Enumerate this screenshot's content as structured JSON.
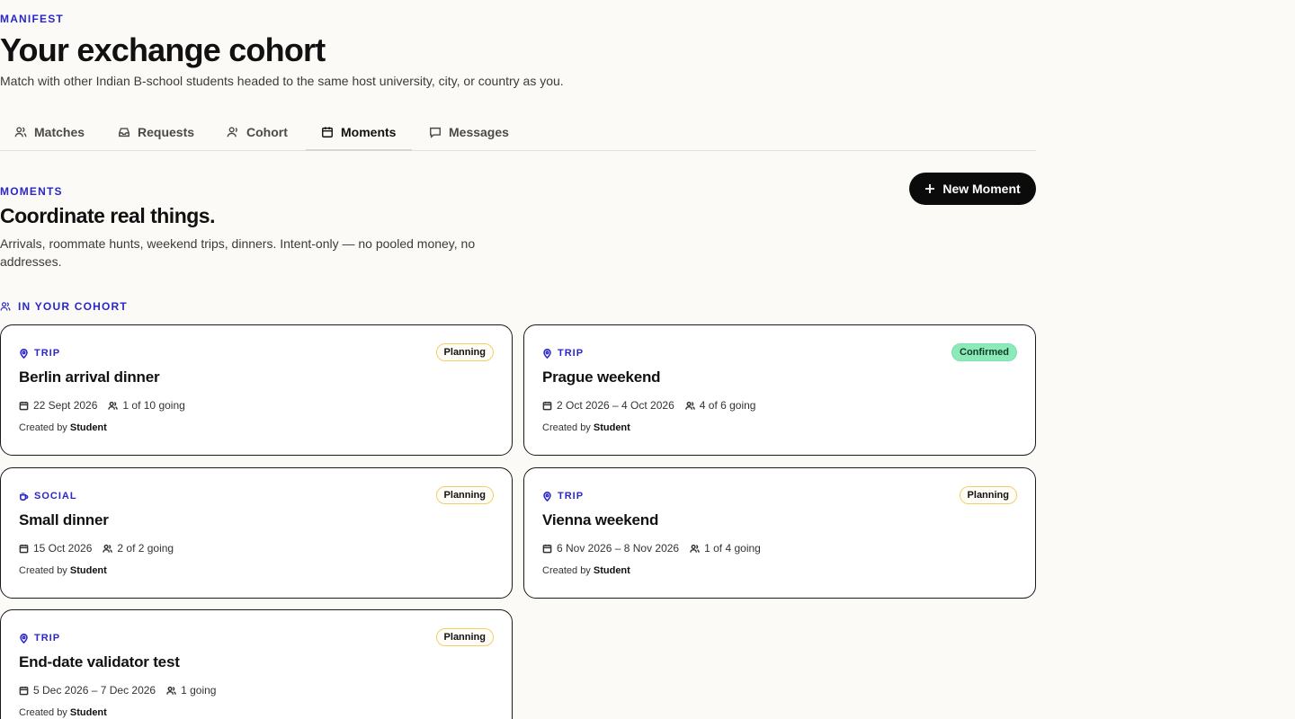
{
  "page": {
    "eyebrow": "MANIFEST",
    "title": "Your exchange cohort",
    "subtitle": "Match with other Indian B-school students headed to the same host university, city, or country as you."
  },
  "tabs": [
    {
      "label": "Matches",
      "icon": "users-icon"
    },
    {
      "label": "Requests",
      "icon": "inbox-icon"
    },
    {
      "label": "Cohort",
      "icon": "user-icon"
    },
    {
      "label": "Moments",
      "icon": "calendar-icon",
      "active": true
    },
    {
      "label": "Messages",
      "icon": "message-icon"
    }
  ],
  "section": {
    "eyebrow": "MOMENTS",
    "title": "Coordinate real things.",
    "subtitle": "Arrivals, roommate hunts, weekend trips, dinners. Intent-only — no pooled money, no addresses.",
    "new_button": "New Moment",
    "group_label": "IN YOUR COHORT"
  },
  "cards": [
    {
      "kind": "TRIP",
      "kind_icon": "map-pin-icon",
      "status": "Planning",
      "title": "Berlin arrival dinner",
      "date": "22 Sept 2026",
      "going": "1 of 10 going",
      "created_prefix": "Created by",
      "creator": "Student"
    },
    {
      "kind": "TRIP",
      "kind_icon": "map-pin-icon",
      "status": "Confirmed",
      "title": "Prague weekend",
      "date": "2 Oct 2026 – 4 Oct 2026",
      "going": "4 of 6 going",
      "created_prefix": "Created by",
      "creator": "Student"
    },
    {
      "kind": "SOCIAL",
      "kind_icon": "cup-icon",
      "status": "Planning",
      "title": "Small dinner",
      "date": "15 Oct 2026",
      "going": "2 of 2 going",
      "created_prefix": "Created by",
      "creator": "Student"
    },
    {
      "kind": "TRIP",
      "kind_icon": "map-pin-icon",
      "status": "Planning",
      "title": "Vienna weekend",
      "date": "6 Nov 2026 – 8 Nov 2026",
      "going": "1 of 4 going",
      "created_prefix": "Created by",
      "creator": "Student"
    },
    {
      "kind": "TRIP",
      "kind_icon": "map-pin-icon",
      "status": "Planning",
      "title": "End-date validator test",
      "date": "5 Dec 2026 – 7 Dec 2026",
      "going": "1 going",
      "created_prefix": "Created by",
      "creator": "Student"
    }
  ],
  "colors": {
    "accent": "#2a27c9",
    "background": "#fbfaf6",
    "confirmed": "#8ceab9",
    "planning_border": "#f0cf6b"
  }
}
